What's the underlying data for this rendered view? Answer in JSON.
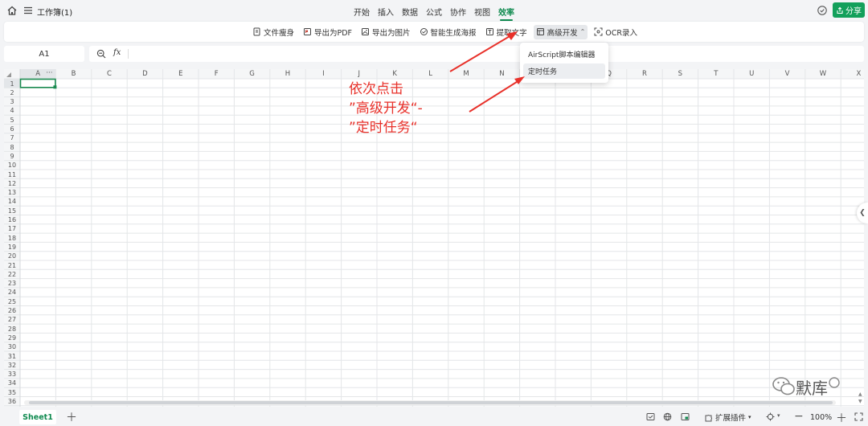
{
  "topbar": {
    "title": "工作簿(1)",
    "tabs": [
      {
        "label": "开始",
        "active": false
      },
      {
        "label": "插入",
        "active": false
      },
      {
        "label": "数据",
        "active": false
      },
      {
        "label": "公式",
        "active": false
      },
      {
        "label": "协作",
        "active": false
      },
      {
        "label": "视图",
        "active": false
      },
      {
        "label": "效率",
        "active": true
      }
    ],
    "share_label": "分享"
  },
  "ribbon": {
    "items": [
      {
        "label": "文件瘦身",
        "icon": "file-slim-icon"
      },
      {
        "label": "导出为PDF",
        "icon": "export-pdf-icon"
      },
      {
        "label": "导出为图片",
        "icon": "export-image-icon"
      },
      {
        "label": "智能生成海报",
        "icon": "smart-poster-icon"
      },
      {
        "label": "提取文字",
        "icon": "extract-text-icon"
      },
      {
        "label": "高级开发",
        "icon": "advanced-dev-icon",
        "dropdown": true,
        "selected": true
      },
      {
        "label": "OCR录入",
        "icon": "ocr-icon"
      }
    ]
  },
  "dropdown": {
    "items": [
      {
        "label": "AirScript脚本编辑器",
        "hover": false
      },
      {
        "label": "定时任务",
        "hover": true
      }
    ]
  },
  "formula": {
    "name_box": "A1",
    "fx": "fx"
  },
  "grid": {
    "columns": [
      "A",
      "B",
      "C",
      "D",
      "E",
      "F",
      "G",
      "H",
      "I",
      "J",
      "K",
      "L",
      "M",
      "N",
      "O",
      "P",
      "Q",
      "R",
      "S",
      "T",
      "U",
      "V",
      "W",
      "X"
    ],
    "row_count": 36,
    "selected_cell": "A1"
  },
  "annotation": {
    "line1": "依次点击",
    "line2": "”高级开发“-",
    "line3": "”定时任务“"
  },
  "statusbar": {
    "sheet_tab": "Sheet1",
    "plugin_label": "扩展插件",
    "zoom": "100%"
  },
  "watermark": {
    "text": "默库"
  },
  "colors": {
    "accent": "#0f8a4f",
    "share_button": "#13a05b",
    "annotation": "#e8312a"
  }
}
